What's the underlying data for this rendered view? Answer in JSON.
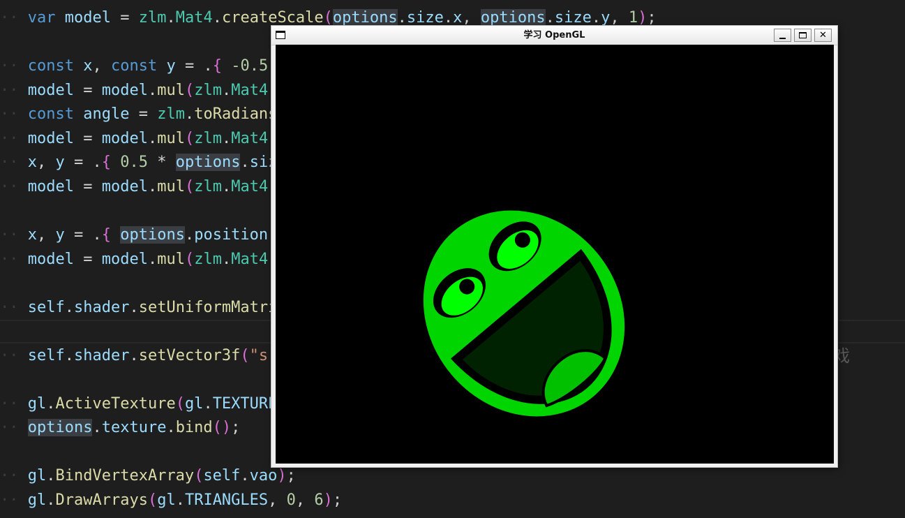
{
  "code": {
    "lines": [
      {
        "tokens": [
          [
            "kw",
            "var"
          ],
          [
            "",
            " "
          ],
          [
            "id",
            "model"
          ],
          [
            "",
            " = "
          ],
          [
            "ty",
            "zlm"
          ],
          [
            "",
            "."
          ],
          [
            "ty",
            "Mat4"
          ],
          [
            "",
            "."
          ],
          [
            "fn",
            "createScale"
          ],
          [
            "brk2",
            "("
          ],
          [
            "id hl",
            "options"
          ],
          [
            "",
            "."
          ],
          [
            "id",
            "size"
          ],
          [
            "",
            "."
          ],
          [
            "id",
            "x"
          ],
          [
            "",
            ", "
          ],
          [
            "id hl",
            "options"
          ],
          [
            "",
            "."
          ],
          [
            "id",
            "size"
          ],
          [
            "",
            "."
          ],
          [
            "id",
            "y"
          ],
          [
            "",
            ", "
          ],
          [
            "num",
            "1"
          ],
          [
            "brk2",
            ")"
          ],
          [
            "",
            ";"
          ]
        ]
      },
      {
        "tokens": []
      },
      {
        "tokens": [
          [
            "kw",
            "const"
          ],
          [
            "",
            " "
          ],
          [
            "id",
            "x"
          ],
          [
            "",
            ", "
          ],
          [
            "kw",
            "const"
          ],
          [
            "",
            " "
          ],
          [
            "id",
            "y"
          ],
          [
            "",
            " = ."
          ],
          [
            "brk2",
            "{"
          ],
          [
            "",
            " "
          ],
          [
            "num",
            "-0.5"
          ]
        ]
      },
      {
        "tokens": [
          [
            "id",
            "model"
          ],
          [
            "",
            " = "
          ],
          [
            "id",
            "model"
          ],
          [
            "",
            "."
          ],
          [
            "fn",
            "mul"
          ],
          [
            "brk2",
            "("
          ],
          [
            "ty",
            "zlm"
          ],
          [
            "",
            "."
          ],
          [
            "ty",
            "Mat4"
          ]
        ]
      },
      {
        "tokens": [
          [
            "kw",
            "const"
          ],
          [
            "",
            " "
          ],
          [
            "id",
            "angle"
          ],
          [
            "",
            " = "
          ],
          [
            "ty",
            "zlm"
          ],
          [
            "",
            "."
          ],
          [
            "fn",
            "toRadians"
          ]
        ]
      },
      {
        "tokens": [
          [
            "id",
            "model"
          ],
          [
            "",
            " = "
          ],
          [
            "id",
            "model"
          ],
          [
            "",
            "."
          ],
          [
            "fn",
            "mul"
          ],
          [
            "brk2",
            "("
          ],
          [
            "ty",
            "zlm"
          ],
          [
            "",
            "."
          ],
          [
            "ty",
            "Mat4"
          ]
        ]
      },
      {
        "tokens": [
          [
            "id",
            "x"
          ],
          [
            "",
            ", "
          ],
          [
            "id",
            "y"
          ],
          [
            "",
            " = ."
          ],
          [
            "brk2",
            "{"
          ],
          [
            "",
            " "
          ],
          [
            "num",
            "0.5"
          ],
          [
            "",
            " * "
          ],
          [
            "id hl",
            "options"
          ],
          [
            "",
            "."
          ],
          [
            "id",
            "size"
          ]
        ]
      },
      {
        "tokens": [
          [
            "id",
            "model"
          ],
          [
            "",
            " = "
          ],
          [
            "id",
            "model"
          ],
          [
            "",
            "."
          ],
          [
            "fn",
            "mul"
          ],
          [
            "brk2",
            "("
          ],
          [
            "ty",
            "zlm"
          ],
          [
            "",
            "."
          ],
          [
            "ty",
            "Mat4"
          ]
        ]
      },
      {
        "tokens": []
      },
      {
        "tokens": [
          [
            "id",
            "x"
          ],
          [
            "",
            ", "
          ],
          [
            "id",
            "y"
          ],
          [
            "",
            " = ."
          ],
          [
            "brk2",
            "{"
          ],
          [
            "",
            " "
          ],
          [
            "id hl",
            "options"
          ],
          [
            "",
            "."
          ],
          [
            "id",
            "position"
          ]
        ]
      },
      {
        "tokens": [
          [
            "id",
            "model"
          ],
          [
            "",
            " = "
          ],
          [
            "id",
            "model"
          ],
          [
            "",
            "."
          ],
          [
            "fn",
            "mul"
          ],
          [
            "brk2",
            "("
          ],
          [
            "ty",
            "zlm"
          ],
          [
            "",
            "."
          ],
          [
            "ty",
            "Mat4"
          ]
        ]
      },
      {
        "tokens": []
      },
      {
        "tokens": [
          [
            "id",
            "self"
          ],
          [
            "",
            "."
          ],
          [
            "id",
            "shader"
          ],
          [
            "",
            "."
          ],
          [
            "fn",
            "setUniformMatrix"
          ]
        ]
      },
      {
        "tokens": [],
        "current": true
      },
      {
        "tokens": [
          [
            "id",
            "self"
          ],
          [
            "",
            "."
          ],
          [
            "id",
            "shader"
          ],
          [
            "",
            "."
          ],
          [
            "fn",
            "setVector3f"
          ],
          [
            "brk2",
            "("
          ],
          [
            "str",
            "\"s"
          ]
        ]
      },
      {
        "tokens": []
      },
      {
        "tokens": [
          [
            "id",
            "gl"
          ],
          [
            "",
            "."
          ],
          [
            "fn",
            "ActiveTexture"
          ],
          [
            "brk2",
            "("
          ],
          [
            "id",
            "gl"
          ],
          [
            "",
            "."
          ],
          [
            "id",
            "TEXTURE"
          ]
        ]
      },
      {
        "tokens": [
          [
            "id hl",
            "options"
          ],
          [
            "",
            "."
          ],
          [
            "id",
            "texture"
          ],
          [
            "",
            "."
          ],
          [
            "fn",
            "bind"
          ],
          [
            "brk2",
            "()"
          ],
          [
            "",
            ";"
          ]
        ]
      },
      {
        "tokens": []
      },
      {
        "tokens": [
          [
            "id",
            "gl"
          ],
          [
            "",
            "."
          ],
          [
            "fn",
            "BindVertexArray"
          ],
          [
            "brk2",
            "("
          ],
          [
            "id",
            "self"
          ],
          [
            "",
            "."
          ],
          [
            "id",
            "vao"
          ],
          [
            "brk2",
            ")"
          ],
          [
            "",
            ";"
          ]
        ]
      },
      {
        "tokens": [
          [
            "id",
            "gl"
          ],
          [
            "",
            "."
          ],
          [
            "fn",
            "DrawArrays"
          ],
          [
            "brk2",
            "("
          ],
          [
            "id",
            "gl"
          ],
          [
            "",
            "."
          ],
          [
            "id",
            "TRIANGLES"
          ],
          [
            "",
            ", "
          ],
          [
            "num",
            "0"
          ],
          [
            "",
            ", "
          ],
          [
            "num",
            "6"
          ],
          [
            "brk2",
            ")"
          ],
          [
            "",
            ";"
          ]
        ]
      }
    ],
    "inline_hint": "游戏"
  },
  "window": {
    "title": "学习 OpenGL",
    "minimize_icon": "minimize-icon",
    "maximize_icon": "maximize-icon",
    "close_label": "✕"
  },
  "sprite": {
    "icon": "awesome-face-icon",
    "colors": {
      "face": "#00d500",
      "eye": "#00ff00",
      "mouth": "#002200",
      "tongue": "#00c000",
      "outline": "#000000",
      "background": "#000000"
    }
  }
}
